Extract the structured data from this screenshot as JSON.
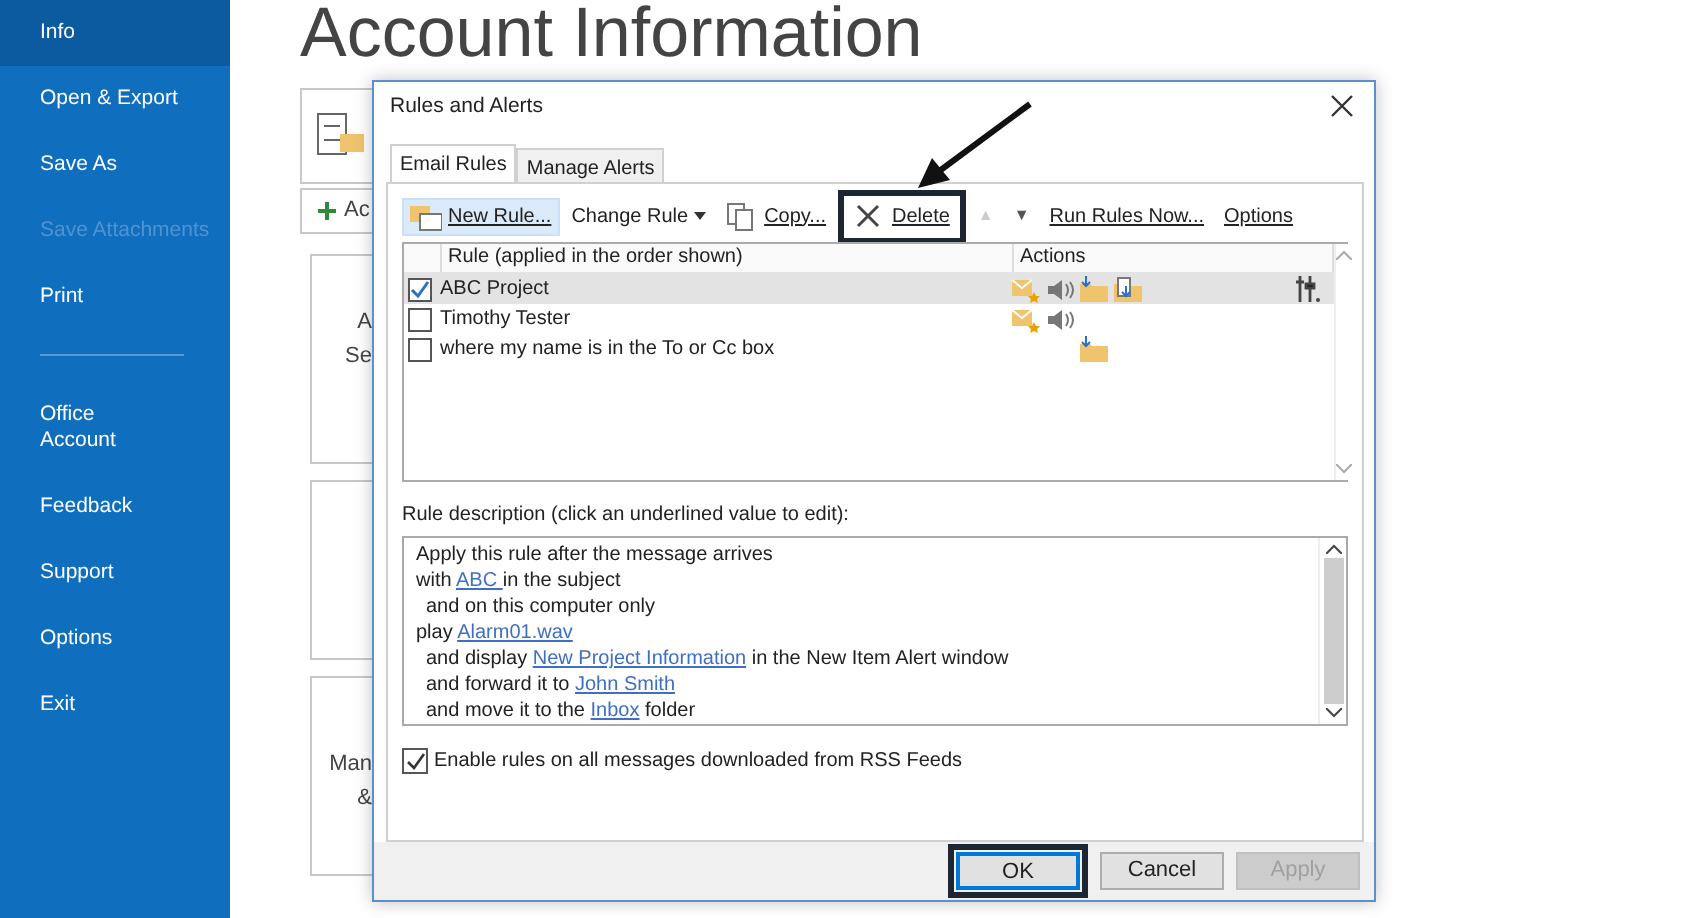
{
  "sidebar": {
    "items": [
      {
        "label": "Info",
        "selected": true,
        "disabled": false
      },
      {
        "label": "Open & Export",
        "selected": false,
        "disabled": false
      },
      {
        "label": "Save As",
        "selected": false,
        "disabled": false
      },
      {
        "label": "Save Attachments",
        "selected": false,
        "disabled": true
      },
      {
        "label": "Print",
        "selected": false,
        "disabled": false
      },
      {
        "kind": "divider"
      },
      {
        "label": "Office\nAccount",
        "selected": false,
        "disabled": false
      },
      {
        "label": "Feedback",
        "selected": false,
        "disabled": false
      },
      {
        "label": "Support",
        "selected": false,
        "disabled": false
      },
      {
        "label": "Options",
        "selected": false,
        "disabled": false
      },
      {
        "label": "Exit",
        "selected": false,
        "disabled": false
      }
    ]
  },
  "page": {
    "title": "Account Information",
    "add_button": "Ac",
    "cards": [
      {
        "kind": "labeled",
        "lines": [
          "A",
          "Se"
        ]
      },
      {
        "kind": "blank"
      },
      {
        "kind": "labeled",
        "lines": [
          "Man",
          "&"
        ]
      }
    ]
  },
  "dialog": {
    "title": "Rules and Alerts",
    "tabs": [
      {
        "label": "Email Rules",
        "selected": true
      },
      {
        "label": "Manage Alerts",
        "selected": false
      }
    ],
    "toolbar": [
      {
        "kind": "new",
        "label": "New Rule...",
        "hover": true,
        "callout": false
      },
      {
        "kind": "dropdown",
        "label": "Change Rule",
        "hover": false,
        "callout": false
      },
      {
        "kind": "copy",
        "label": "Copy...",
        "hover": false,
        "callout": false
      },
      {
        "kind": "delete",
        "label": "Delete",
        "hover": false,
        "callout": true
      },
      {
        "kind": "up",
        "label": "▲",
        "hover": false,
        "callout": false,
        "disabled": true
      },
      {
        "kind": "down",
        "label": "▼",
        "hover": false,
        "callout": false,
        "disabled": false
      },
      {
        "kind": "plain",
        "label": "Run Rules Now...",
        "hover": false,
        "callout": false
      },
      {
        "kind": "plain",
        "label": "Options",
        "hover": false,
        "callout": false
      }
    ],
    "rules_table": {
      "columns": [
        "Rule (applied in the order shown)",
        "Actions"
      ],
      "rows": [
        {
          "name": "ABC Project",
          "checked": true,
          "selected": true,
          "actions": [
            {
              "kind": "alert"
            },
            {
              "kind": "sound"
            },
            {
              "kind": "move"
            },
            {
              "kind": "copy"
            }
          ],
          "options": true
        },
        {
          "name": "Timothy Tester",
          "checked": false,
          "selected": false,
          "actions": [
            {
              "kind": "alert"
            },
            {
              "kind": "sound"
            }
          ],
          "options": false
        },
        {
          "name": "where my name is in the To or Cc box",
          "checked": false,
          "selected": false,
          "actions": [
            {
              "kind": "empty"
            },
            {
              "kind": "empty"
            },
            {
              "kind": "move"
            }
          ],
          "options": false
        }
      ]
    },
    "description_label": "Rule description (click an underlined value to edit):",
    "description": [
      {
        "parts": [
          {
            "text": "Apply this rule after the message arrives"
          }
        ]
      },
      {
        "parts": [
          {
            "text": "with "
          },
          {
            "text": "ABC ",
            "link": true
          },
          {
            "text": " in the subject"
          }
        ]
      },
      {
        "indent": true,
        "parts": [
          {
            "text": "and on this computer only"
          }
        ]
      },
      {
        "parts": [
          {
            "text": "play "
          },
          {
            "text": "Alarm01.wav",
            "link": true
          }
        ]
      },
      {
        "indent": true,
        "parts": [
          {
            "text": "and display "
          },
          {
            "text": "New Project Information",
            "link": true
          },
          {
            "text": " in the New Item Alert window"
          }
        ]
      },
      {
        "indent": true,
        "parts": [
          {
            "text": "and forward it to "
          },
          {
            "text": "John Smith",
            "link": true
          }
        ]
      },
      {
        "indent": true,
        "parts": [
          {
            "text": "and move it to the "
          },
          {
            "text": "Inbox",
            "link": true
          },
          {
            "text": " folder"
          }
        ]
      }
    ],
    "rss_option": {
      "label": "Enable rules on all messages downloaded from RSS Feeds",
      "checked": true
    },
    "buttons": [
      {
        "label": "OK",
        "kind": "default",
        "callout": true,
        "disabled": false
      },
      {
        "label": "Cancel",
        "kind": "normal",
        "callout": false,
        "disabled": false
      },
      {
        "label": "Apply",
        "kind": "normal",
        "callout": false,
        "disabled": true
      }
    ]
  }
}
